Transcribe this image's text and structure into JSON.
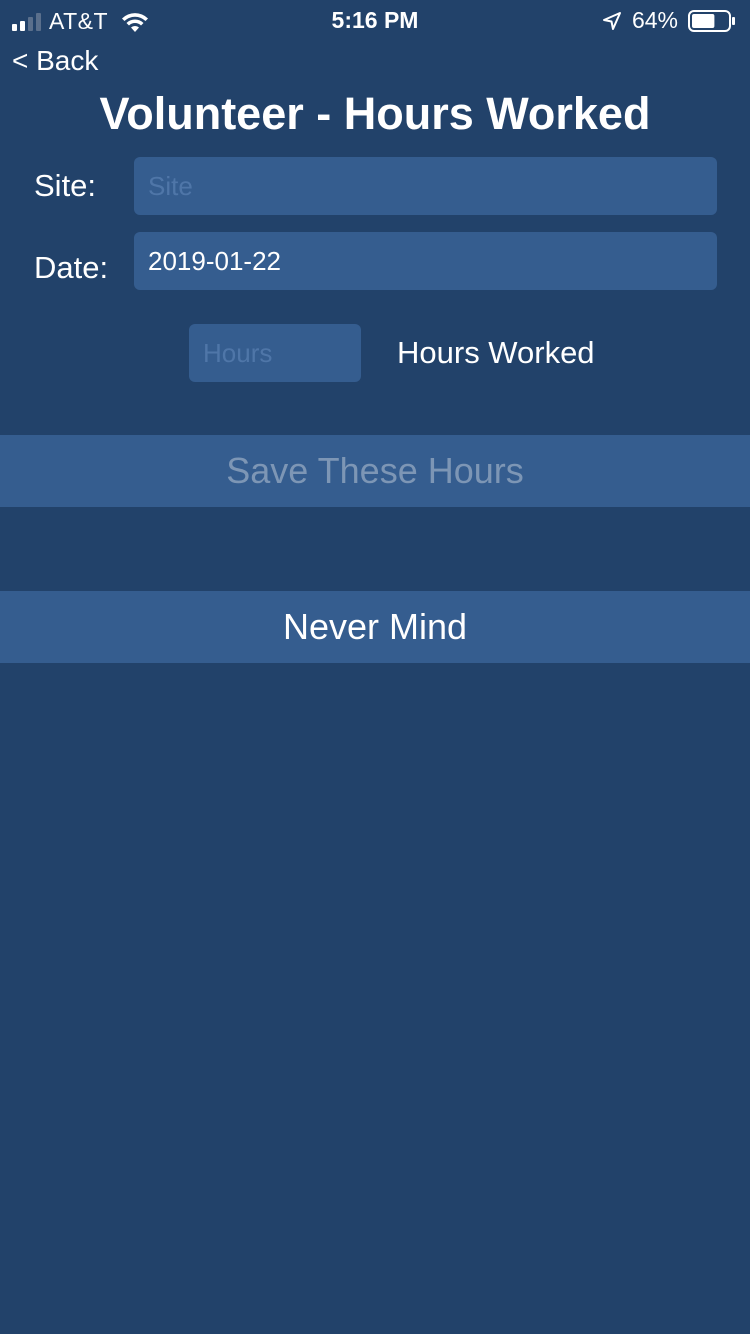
{
  "status_bar": {
    "carrier": "AT&T",
    "time": "5:16 PM",
    "battery_percent": "64%",
    "signal_bars": 2,
    "signal_total": 4,
    "battery_level": 0.64,
    "icons": [
      "signal-icon",
      "wifi-icon",
      "location-arrow-icon",
      "battery-icon"
    ]
  },
  "nav": {
    "back_label": "< Back"
  },
  "page": {
    "title": "Volunteer - Hours Worked"
  },
  "form": {
    "site_label": "Site:",
    "site_placeholder": "Site",
    "site_value": "",
    "date_label": "Date:",
    "date_value": "2019-01-22",
    "hours_placeholder": "Hours",
    "hours_value": "",
    "hours_label": "Hours Worked"
  },
  "actions": {
    "save_label": "Save These Hours",
    "cancel_label": "Never Mind"
  },
  "colors": {
    "background": "#22426a",
    "field": "#355d8f",
    "placeholder": "#4f76a8",
    "disabled_text": "#7d96b5",
    "text": "#ffffff"
  }
}
